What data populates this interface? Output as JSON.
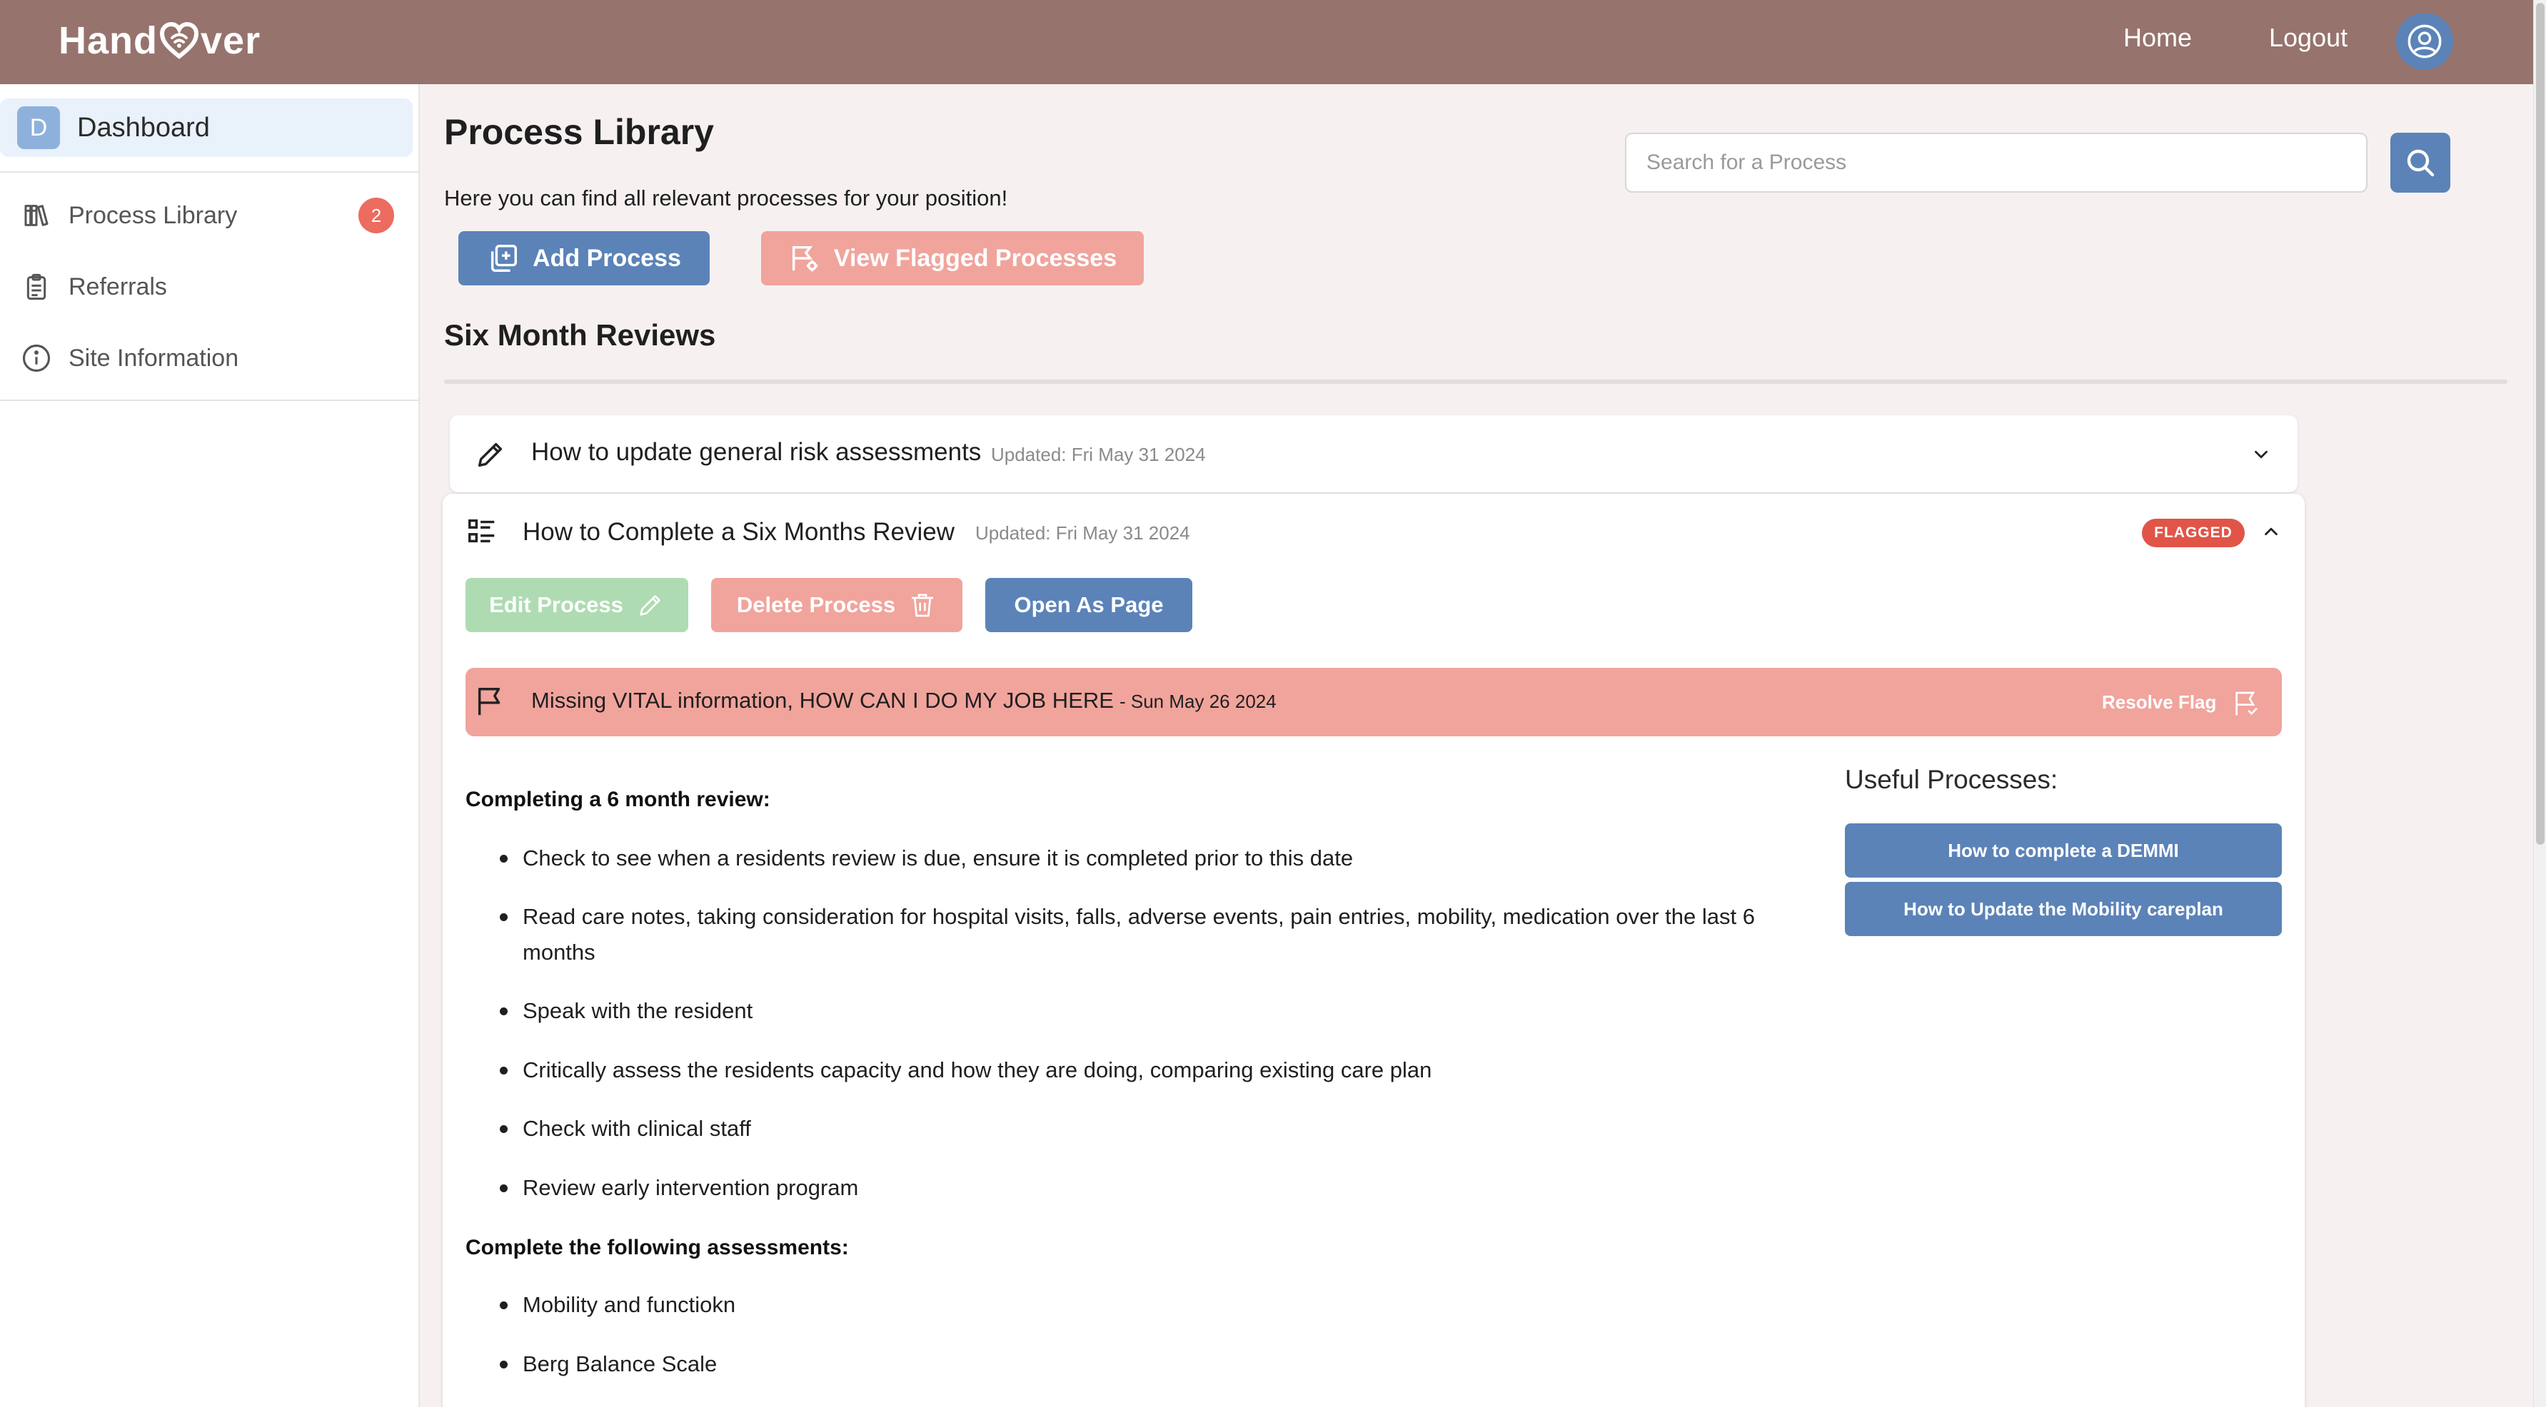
{
  "header": {
    "logo_left": "Hand",
    "logo_right": "ver",
    "nav": {
      "home": "Home",
      "logout": "Logout"
    }
  },
  "sidebar": {
    "dashboard": {
      "avatar_letter": "D",
      "label": "Dashboard"
    },
    "items": [
      {
        "label": "Process Library",
        "icon": "books-icon",
        "badge": "2"
      },
      {
        "label": "Referrals",
        "icon": "clipboard-icon"
      },
      {
        "label": "Site Information",
        "icon": "info-icon"
      }
    ]
  },
  "main": {
    "title": "Process Library",
    "subtitle": "Here you can find all relevant processes for your position!",
    "search": {
      "placeholder": "Search for a Process",
      "value": ""
    },
    "buttons": {
      "add": "Add Process",
      "flagged": "View Flagged Processes"
    },
    "section_title": "Six Month Reviews",
    "processes": [
      {
        "title": "How to update general risk assessments",
        "updated": "Updated: Fri May 31 2024",
        "icon": "pencil-icon",
        "expanded": false
      },
      {
        "title": "How to Complete a Six Months Review",
        "updated": "Updated: Fri May 31 2024",
        "icon": "list-icon",
        "expanded": true,
        "badge": "FLAGGED",
        "actions": {
          "edit": "Edit Process",
          "delete": "Delete Process",
          "open": "Open As Page"
        },
        "flag": {
          "message": "Missing VITAL information, HOW CAN I DO MY JOB HERE",
          "date": "- Sun May 26 2024",
          "resolve": "Resolve Flag"
        },
        "content": {
          "heading1": "Completing a 6 month review:",
          "bullets1": [
            "Check to see when a residents review is due, ensure it is completed prior to this date",
            "Read care notes, taking consideration for hospital visits, falls, adverse events, pain entries, mobility, medication over the last 6 months",
            "Speak with the resident",
            "Critically assess the residents capacity and how they are doing, comparing existing care plan",
            "Check with clinical staff",
            "Review early intervention program"
          ],
          "heading2": "Complete the following assessments:",
          "bullets2": [
            "Mobility and functiokn",
            "Berg Balance Scale"
          ]
        },
        "useful": {
          "title": "Useful Processes:",
          "links": [
            "How to complete a DEMMI",
            "How to Update the Mobility careplan"
          ]
        }
      }
    ]
  },
  "colors": {
    "header": "#96736d",
    "primary": "#5b83b8",
    "danger_light": "#f0a49c",
    "success_light": "#aedbb2",
    "flag_badge": "#e05548"
  }
}
